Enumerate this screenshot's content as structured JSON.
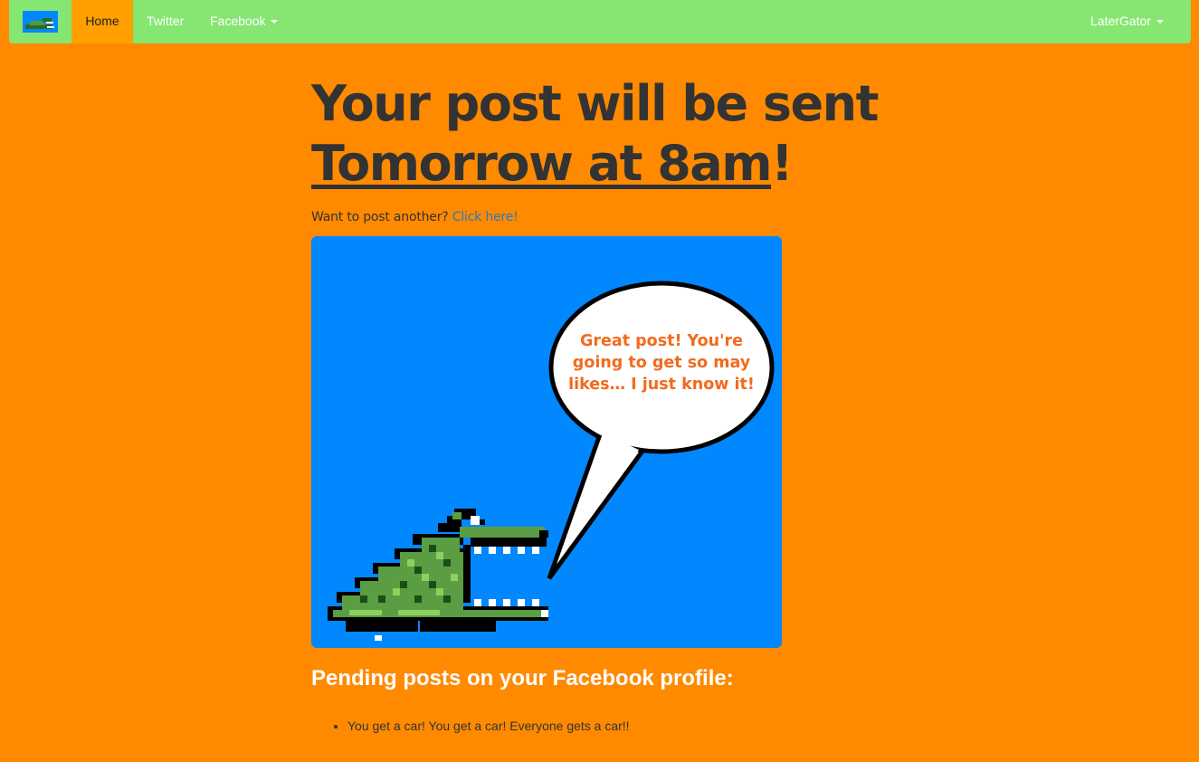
{
  "navbar": {
    "logo_icon": "gator-logo-icon",
    "home_label": "Home",
    "twitter_label": "Twitter",
    "facebook_label": "Facebook",
    "user_label": "LaterGator",
    "colors": {
      "bar": "#86e672",
      "active": "#ff9f00"
    }
  },
  "headline": {
    "line1": "Your post will be sent",
    "scheduled_time": "Tomorrow at 8am",
    "exclaim": "!"
  },
  "post_another": {
    "prompt": "Want to post another?",
    "link_label": "Click here!"
  },
  "illustration": {
    "icon": "pixel-gator-icon",
    "speech": "Great post! You're going to get so may likes… I just know it!",
    "colors": {
      "background": "#0188ff",
      "speech_text": "#f26b1d",
      "gator": "#5a9d43"
    }
  },
  "pending": {
    "title": "Pending posts on your Facebook profile:",
    "items": [
      "You get a car! You get a car! Everyone gets a car!!"
    ]
  },
  "page": {
    "background": "#ff8a00"
  }
}
